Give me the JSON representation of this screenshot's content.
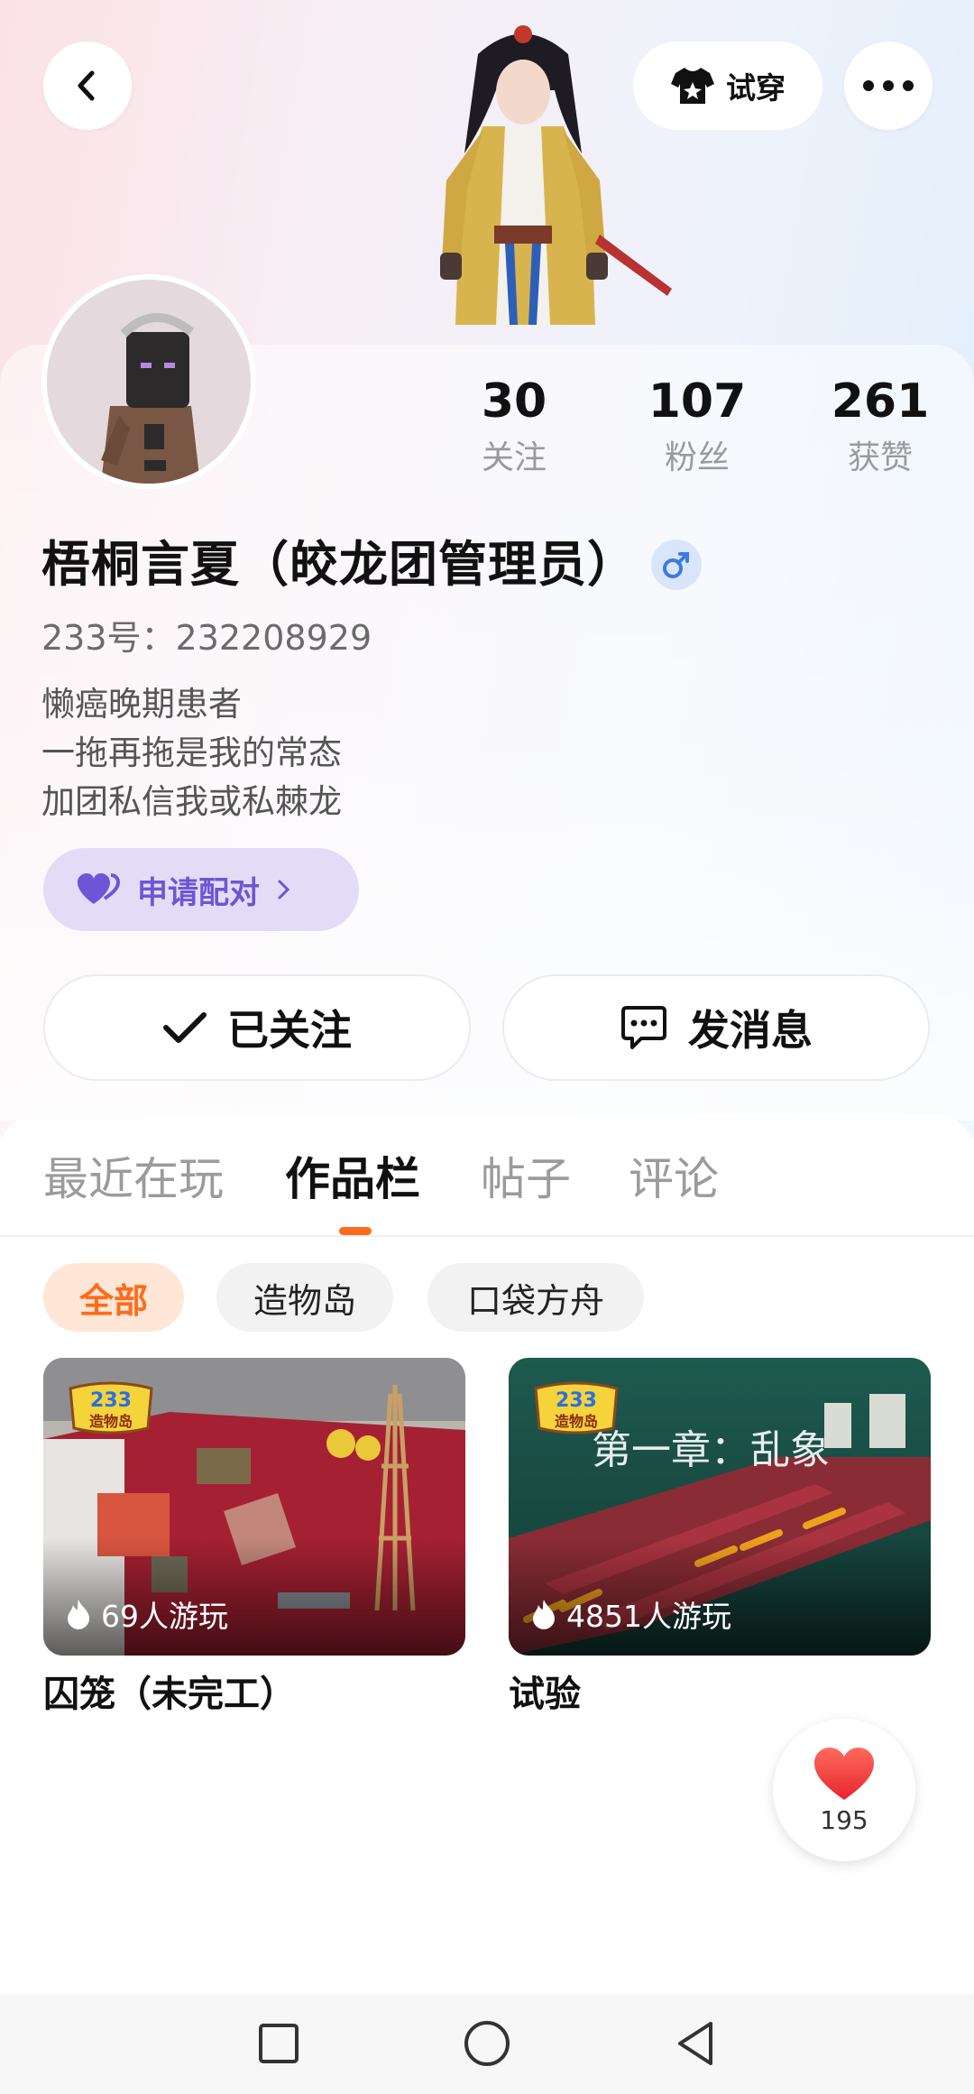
{
  "header": {
    "back_icon": "chevron-left-icon",
    "tryon_label": "试穿",
    "tryon_icon": "tshirt-icon",
    "more_icon": "more-horizontal-icon"
  },
  "profile": {
    "stats": [
      {
        "value": "30",
        "label": "关注"
      },
      {
        "value": "107",
        "label": "粉丝"
      },
      {
        "value": "261",
        "label": "获赞"
      }
    ],
    "username": "梧桐言夏（皎龙团管理员）",
    "gender_icon": "male-icon",
    "uid": "233号：232208929",
    "bio": [
      "懒癌晚期患者",
      "一拖再拖是我的常态",
      "加团私信我或私棘龙"
    ],
    "pair_label": "申请配对",
    "follow_label": "已关注",
    "message_label": "发消息"
  },
  "tabs": [
    "最近在玩",
    "作品栏",
    "帖子",
    "评论"
  ],
  "active_tab": "作品栏",
  "filters": [
    "全部",
    "造物岛",
    "口袋方舟"
  ],
  "active_filter": "全部",
  "works": [
    {
      "title": "囚笼（未完工）",
      "plays": "69人游玩",
      "badge_top": "233",
      "badge_bottom": "造物岛"
    },
    {
      "title": "试验",
      "plays": "4851人游玩",
      "badge_top": "233",
      "badge_bottom": "造物岛",
      "overlay_text": "第一章：乱象"
    }
  ],
  "like": {
    "count": "195"
  },
  "colors": {
    "accent": "#ff6b1a",
    "pair": "#6e55d6",
    "gender_bg": "#d9e6fa"
  }
}
